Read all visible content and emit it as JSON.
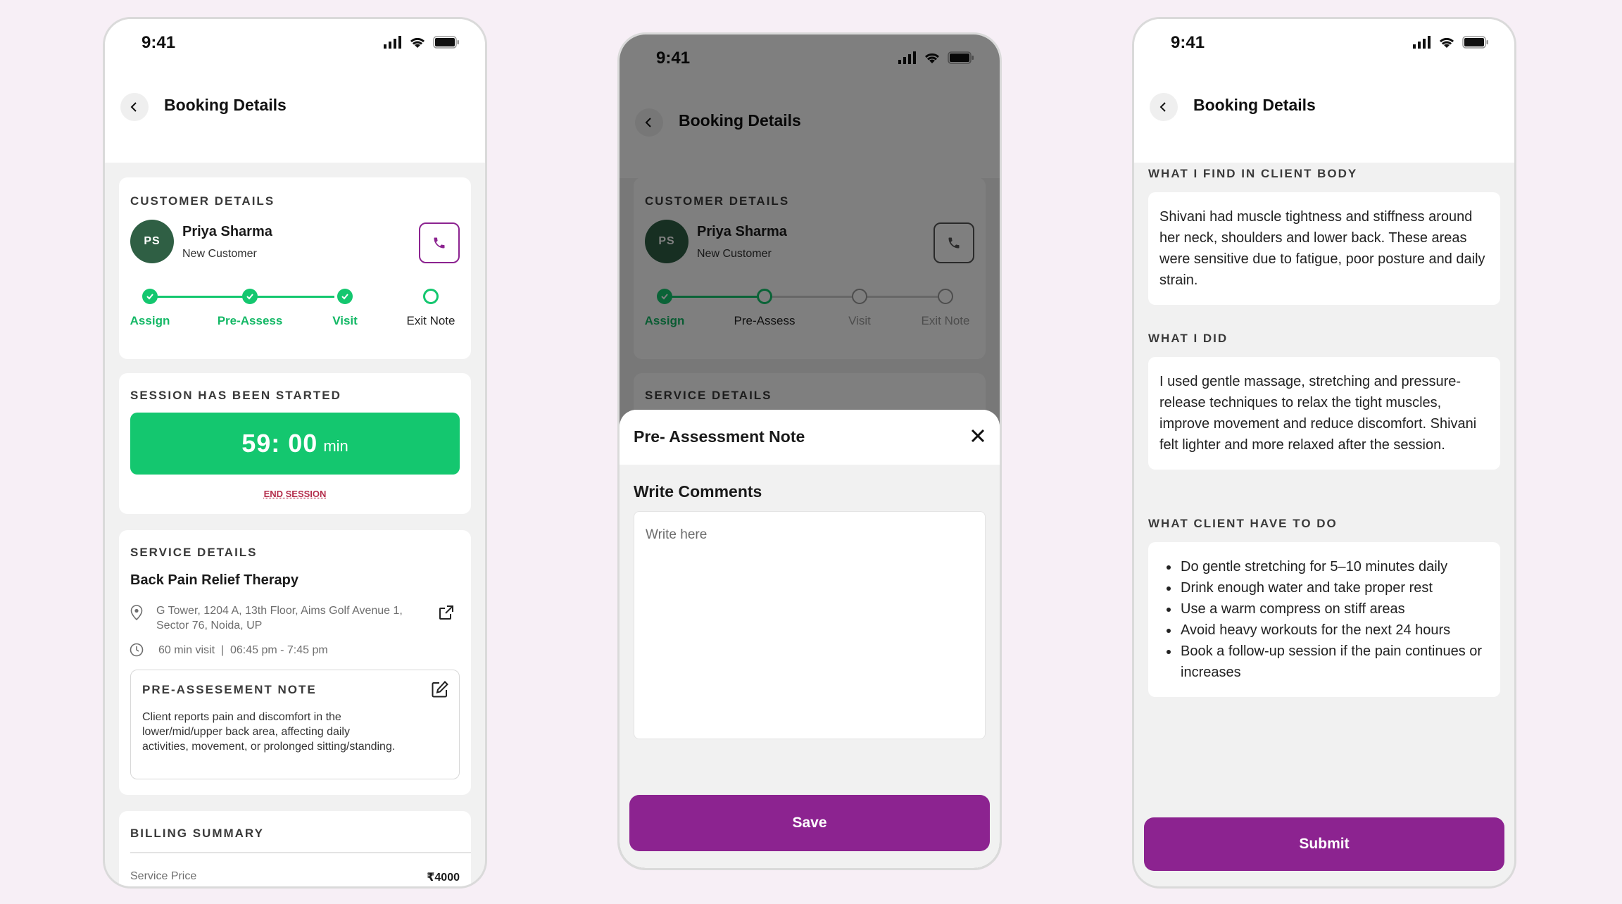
{
  "status_time": "9:41",
  "screen1": {
    "title": "Booking Details",
    "customer_section": "CUSTOMER DETAILS",
    "avatar_initials": "PS",
    "customer_name": "Priya Sharma",
    "customer_type": "New Customer",
    "steps": [
      {
        "label": "Assign",
        "state": "done"
      },
      {
        "label": "Pre-Assess",
        "state": "done"
      },
      {
        "label": "Visit",
        "state": "done"
      },
      {
        "label": "Exit Note",
        "state": "current"
      }
    ],
    "session_section": "SESSION HAS BEEN STARTED",
    "timer_value": "59: 00",
    "timer_unit": "min",
    "end_session": "END SESSION",
    "service_section": "SERVICE DETAILS",
    "service_name": "Back Pain Relief Therapy",
    "address": "G Tower, 1204 A, 13th Floor, Aims Golf Avenue 1, Sector 76, Noida, UP",
    "visit_info": "60 min visit  |  06:45 pm - 7:45 pm",
    "note_title": "PRE-ASSESEMENT NOTE",
    "note_text": "Client reports pain and discomfort in the lower/mid/upper back area, affecting daily activities, movement, or prolonged sitting/standing.",
    "billing_section": "BILLING SUMMARY",
    "billing_label": "Service Price",
    "billing_value": "₹4000"
  },
  "screen2": {
    "title": "Booking Details",
    "customer_section": "CUSTOMER DETAILS",
    "avatar_initials": "PS",
    "customer_name": "Priya Sharma",
    "customer_type": "New Customer",
    "steps": [
      {
        "label": "Assign",
        "state": "done"
      },
      {
        "label": "Pre-Assess",
        "state": "current"
      },
      {
        "label": "Visit",
        "state": "pending"
      },
      {
        "label": "Exit Note",
        "state": "pending"
      }
    ],
    "service_section": "SERVICE DETAILS",
    "sheet_title": "Pre- Assessment Note",
    "write_label": "Write Comments",
    "placeholder": "Write here",
    "save_label": "Save"
  },
  "screen3": {
    "title": "Booking Details",
    "find_label": "WHAT I FIND IN CLIENT BODY",
    "find_text": "Shivani had muscle tightness and stiffness around her neck, shoulders and lower back. These areas were sensitive due to fatigue, poor posture and daily strain.",
    "did_label": "WHAT I DID",
    "did_text": "I used gentle massage, stretching and pressure-release techniques to relax the tight muscles, improve movement and reduce discomfort. Shivani felt lighter and more relaxed after the session.",
    "todo_label": "WHAT CLIENT HAVE TO DO",
    "todo_items": [
      "Do gentle stretching for 5–10 minutes daily",
      "Drink enough water and take proper rest",
      "Use a warm compress on stiff areas",
      "Avoid heavy workouts for the next 24 hours",
      "Book a follow-up session if the pain continues or increases"
    ],
    "submit_label": "Submit"
  },
  "colors": {
    "accent": "#8c2390",
    "success": "#14c76f",
    "avatar": "#2f5f44",
    "danger": "#b42d4b"
  },
  "icons": [
    "back-arrow-icon",
    "phone-icon",
    "location-pin-icon",
    "clock-icon",
    "external-link-icon",
    "edit-icon",
    "close-icon",
    "check-icon",
    "signal-icon",
    "wifi-icon",
    "battery-icon"
  ]
}
